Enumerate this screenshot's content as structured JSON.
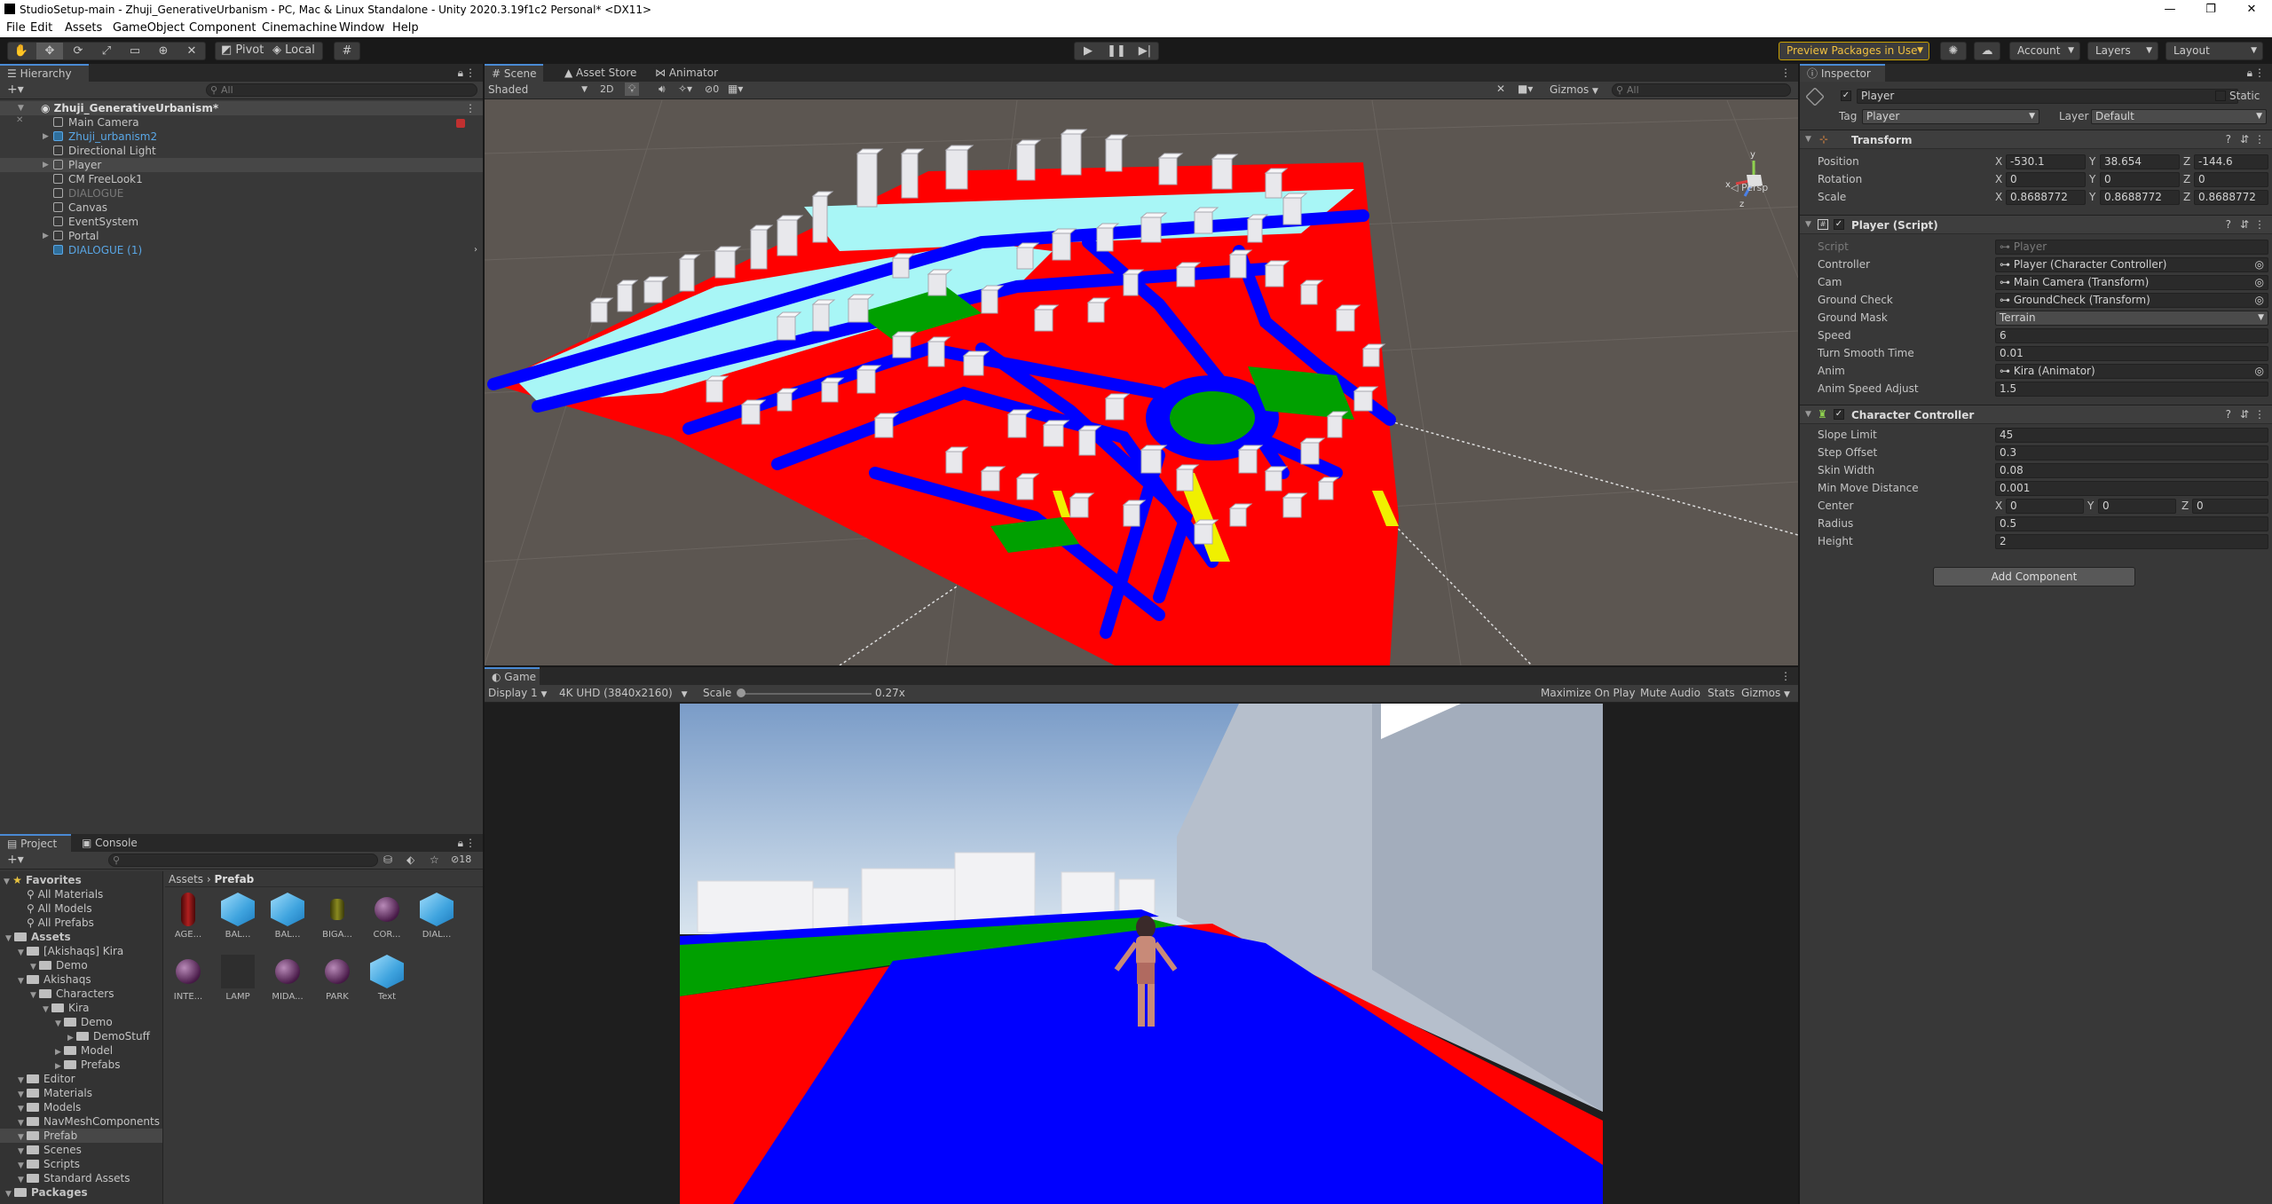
{
  "window": {
    "title": "StudioSetup-main - Zhuji_GenerativeUrbanism - PC, Mac & Linux Standalone - Unity 2020.3.19f1c2 Personal* <DX11>",
    "controls": [
      "—",
      "❐",
      "✕"
    ]
  },
  "menu": [
    "File",
    "Edit",
    "Assets",
    "GameObject",
    "Component",
    "Cinemachine",
    "Window",
    "Help"
  ],
  "toolbar": {
    "pivot": "Pivot",
    "local": "Local",
    "preview_packages": "Preview Packages in Use",
    "account": "Account",
    "layers": "Layers",
    "layout": "Layout"
  },
  "hierarchy": {
    "tab": "Hierarchy",
    "search_placeholder": "All",
    "scene": "Zhuji_GenerativeUrbanism*",
    "items": [
      {
        "label": "Main Camera",
        "prefab": false,
        "expand": false
      },
      {
        "label": "Zhuji_urbanism2",
        "prefab": true,
        "expand": true
      },
      {
        "label": "Directional Light",
        "prefab": false,
        "expand": false
      },
      {
        "label": "Player",
        "prefab": false,
        "expand": true
      },
      {
        "label": "CM FreeLook1",
        "prefab": false,
        "expand": false
      },
      {
        "label": "DIALOGUE",
        "prefab": false,
        "expand": false,
        "disabled": true
      },
      {
        "label": "Canvas",
        "prefab": false,
        "expand": false
      },
      {
        "label": "EventSystem",
        "prefab": false,
        "expand": false
      },
      {
        "label": "Portal",
        "prefab": false,
        "expand": true
      },
      {
        "label": "DIALOGUE (1)",
        "prefab": true,
        "expand": false
      }
    ]
  },
  "scene": {
    "tabs": [
      "Scene",
      "Asset Store",
      "Animator"
    ],
    "shading": "Shaded",
    "mode2d": "2D",
    "hidden_count": "0",
    "gizmos": "Gizmos",
    "search_placeholder": "All",
    "persp": "Persp"
  },
  "game": {
    "tab": "Game",
    "display": "Display 1",
    "resolution": "4K UHD (3840x2160)",
    "scale_label": "Scale",
    "scale_value": "0.27x",
    "maximize": "Maximize On Play",
    "mute": "Mute Audio",
    "stats": "Stats",
    "gizmos": "Gizmos"
  },
  "project": {
    "tabs": [
      "Project",
      "Console"
    ],
    "hidden_count": "18",
    "breadcrumb": [
      "Assets",
      "Prefab"
    ],
    "favorites_label": "Favorites",
    "favorites": [
      "All Materials",
      "All Models",
      "All Prefabs"
    ],
    "tree": [
      {
        "label": "Assets",
        "depth": 0,
        "bold": true
      },
      {
        "label": "[Akishaqs] Kira",
        "depth": 1
      },
      {
        "label": "Demo",
        "depth": 2
      },
      {
        "label": "Akishaqs",
        "depth": 1
      },
      {
        "label": "Characters",
        "depth": 2
      },
      {
        "label": "Kira",
        "depth": 3
      },
      {
        "label": "Demo",
        "depth": 4
      },
      {
        "label": "DemoStuff",
        "depth": 5
      },
      {
        "label": "Model",
        "depth": 4
      },
      {
        "label": "Prefabs",
        "depth": 4
      },
      {
        "label": "Editor",
        "depth": 1
      },
      {
        "label": "Materials",
        "depth": 1
      },
      {
        "label": "Models",
        "depth": 1
      },
      {
        "label": "NavMeshComponents",
        "depth": 1
      },
      {
        "label": "Prefab",
        "depth": 1,
        "selected": true
      },
      {
        "label": "Scenes",
        "depth": 1
      },
      {
        "label": "Scripts",
        "depth": 1
      },
      {
        "label": "Standard Assets",
        "depth": 1
      },
      {
        "label": "Packages",
        "depth": 0,
        "bold": true
      }
    ],
    "assets": [
      {
        "label": "AGE...",
        "kind": "capsule-red"
      },
      {
        "label": "BAL...",
        "kind": "prefab"
      },
      {
        "label": "BAL...",
        "kind": "prefab"
      },
      {
        "label": "BIGA...",
        "kind": "capsule-olive"
      },
      {
        "label": "COR...",
        "kind": "sphere"
      },
      {
        "label": "DIAL...",
        "kind": "prefab"
      },
      {
        "label": "INTE...",
        "kind": "sphere"
      },
      {
        "label": "LAMP",
        "kind": "empty"
      },
      {
        "label": "MIDA...",
        "kind": "sphere"
      },
      {
        "label": "PARK",
        "kind": "sphere"
      },
      {
        "label": "Text",
        "kind": "prefab"
      }
    ]
  },
  "inspector": {
    "tab": "Inspector",
    "object_name": "Player",
    "static_label": "Static",
    "tag_label": "Tag",
    "tag_value": "Player",
    "layer_label": "Layer",
    "layer_value": "Default",
    "transform": {
      "title": "Transform",
      "position_label": "Position",
      "rotation_label": "Rotation",
      "scale_label": "Scale",
      "position": [
        "-530.1",
        "38.654",
        "-144.6"
      ],
      "rotation": [
        "0",
        "0",
        "0"
      ],
      "scale": [
        "0.8688772",
        "0.8688772",
        "0.8688772"
      ],
      "axes": [
        "X",
        "Y",
        "Z"
      ]
    },
    "player_script": {
      "title": "Player (Script)",
      "rows": [
        {
          "label": "Script",
          "value": "Player",
          "kind": "ref",
          "disabled": true
        },
        {
          "label": "Controller",
          "value": "Player (Character Controller)",
          "kind": "ref"
        },
        {
          "label": "Cam",
          "value": "Main Camera (Transform)",
          "kind": "ref"
        },
        {
          "label": "Ground Check",
          "value": "GroundCheck (Transform)",
          "kind": "ref"
        },
        {
          "label": "Ground Mask",
          "value": "Terrain",
          "kind": "dropdown"
        },
        {
          "label": "Speed",
          "value": "6",
          "kind": "text"
        },
        {
          "label": "Turn Smooth Time",
          "value": "0.01",
          "kind": "text"
        },
        {
          "label": "Anim",
          "value": "Kira (Animator)",
          "kind": "ref"
        },
        {
          "label": "Anim Speed Adjust",
          "value": "1.5",
          "kind": "text"
        }
      ]
    },
    "character_controller": {
      "title": "Character Controller",
      "rows": [
        {
          "label": "Slope Limit",
          "value": "45"
        },
        {
          "label": "Step Offset",
          "value": "0.3"
        },
        {
          "label": "Skin Width",
          "value": "0.08"
        },
        {
          "label": "Min Move Distance",
          "value": "0.001"
        }
      ],
      "center_label": "Center",
      "center": [
        "0",
        "0",
        "0"
      ],
      "radius_label": "Radius",
      "radius": "0.5",
      "height_label": "Height",
      "height": "2"
    },
    "add_component": "Add Component"
  },
  "colors": {
    "accent": "#4a8ad4",
    "road": "#0000ff",
    "plot": "#ff0000",
    "park": "#00a000",
    "water": "#a8f6f6",
    "prefab_text": "#59a7e6"
  }
}
